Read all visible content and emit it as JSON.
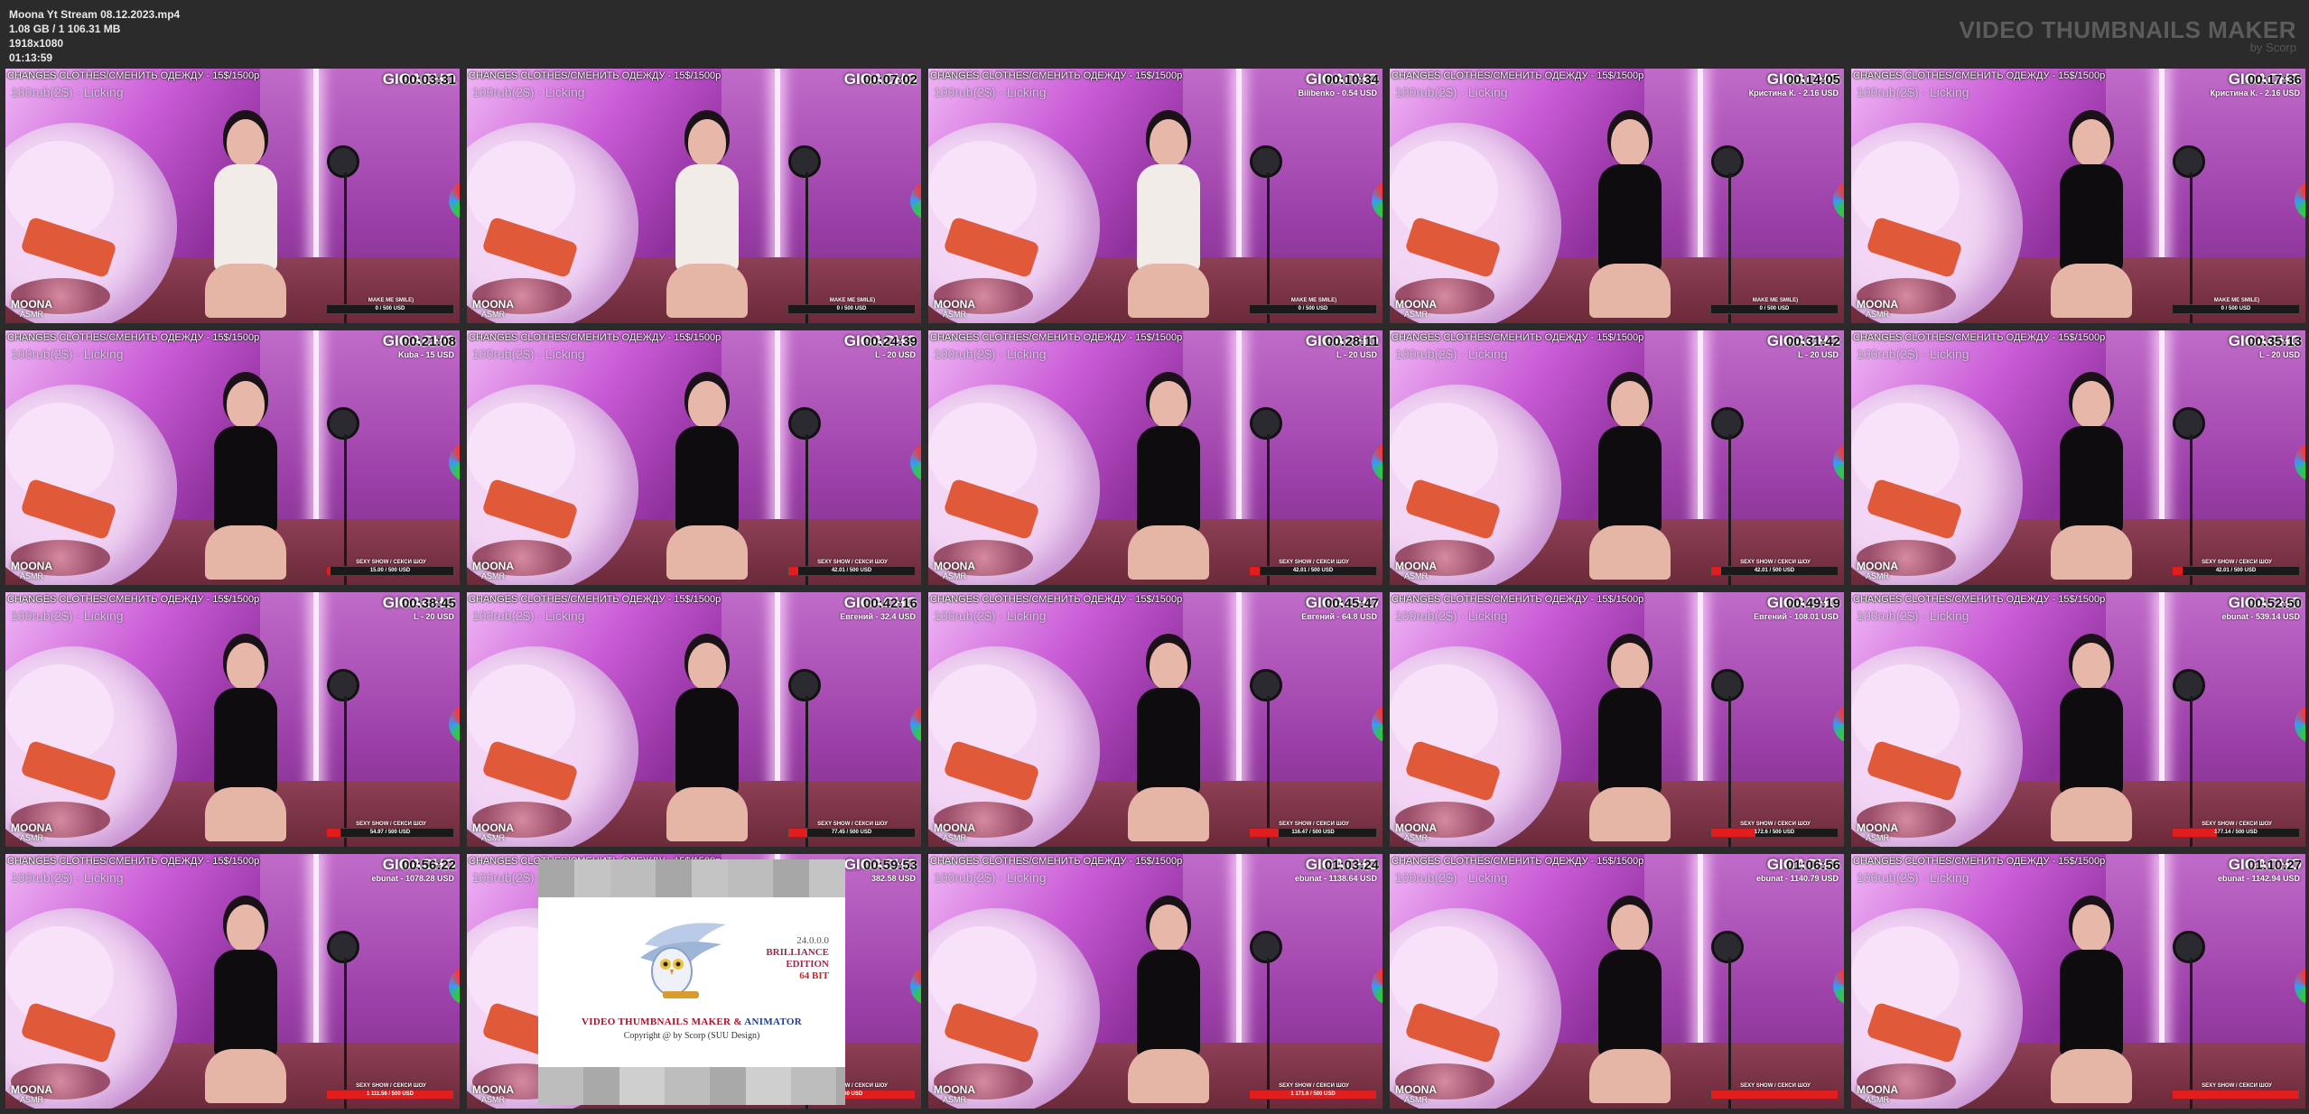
{
  "file": {
    "name": "Moona Yt Stream 08.12.2023.mp4",
    "size": "1.08 GB  / 1 106.31 MB",
    "resolution": "1918x1080",
    "duration": "01:13:59"
  },
  "brand": {
    "title": "VIDEO THUMBNAILS MAKER",
    "subtitle": "by Scorp"
  },
  "overlay": {
    "top_text": "CHANGES CLOTHES/СМЕНИТЬ ОДЕЖДУ - 15$/1500р",
    "sub_text": "100rub(2$) · Licking",
    "channel": "GIGACHO",
    "logo_name": "MOONA",
    "logo_sub": "ASMR"
  },
  "thumbnails": [
    {
      "time": "00:03:31",
      "donor": "",
      "goal_label": "MAKE ME SMILE)",
      "goal_value": "0 / 500 USD",
      "fill": 0.0,
      "outfit": "white"
    },
    {
      "time": "00:07:02",
      "donor": "",
      "goal_label": "MAKE ME SMILE)",
      "goal_value": "0 / 500 USD",
      "fill": 0.0,
      "outfit": "white"
    },
    {
      "time": "00:10:34",
      "donor": "Bilibenko - 0.54 USD",
      "goal_label": "MAKE ME SMILE)",
      "goal_value": "0 / 500 USD",
      "fill": 0.0,
      "outfit": "white"
    },
    {
      "time": "00:14:05",
      "donor": "Кристина К. - 2.16 USD",
      "goal_label": "MAKE ME SMILE)",
      "goal_value": "0 / 500 USD",
      "fill": 0.0,
      "outfit": "black"
    },
    {
      "time": "00:17:36",
      "donor": "Кристина К. - 2.16 USD",
      "goal_label": "MAKE ME SMILE)",
      "goal_value": "0 / 500 USD",
      "fill": 0.0,
      "outfit": "black"
    },
    {
      "time": "00:21:08",
      "donor": "Kuba - 15 USD",
      "goal_label": "SEXY SHOW / СЕКСИ ШОУ",
      "goal_value": "15.00 / 500 USD",
      "fill": 0.03,
      "outfit": "black"
    },
    {
      "time": "00:24:39",
      "donor": "L - 20 USD",
      "goal_label": "SEXY SHOW / СЕКСИ ШОУ",
      "goal_value": "42.01 / 500 USD",
      "fill": 0.08,
      "outfit": "black"
    },
    {
      "time": "00:28:11",
      "donor": "L - 20 USD",
      "goal_label": "SEXY SHOW / СЕКСИ ШОУ",
      "goal_value": "42.01 / 500 USD",
      "fill": 0.08,
      "outfit": "black"
    },
    {
      "time": "00:31:42",
      "donor": "L - 20 USD",
      "goal_label": "SEXY SHOW / СЕКСИ ШОУ",
      "goal_value": "42.01 / 500 USD",
      "fill": 0.08,
      "outfit": "black"
    },
    {
      "time": "00:35:13",
      "donor": "L - 20 USD",
      "goal_label": "SEXY SHOW / СЕКСИ ШОУ",
      "goal_value": "42.01 / 500 USD",
      "fill": 0.08,
      "outfit": "black"
    },
    {
      "time": "00:38:45",
      "donor": "L - 20 USD",
      "goal_label": "SEXY SHOW / СЕКСИ ШОУ",
      "goal_value": "54.97 / 500 USD",
      "fill": 0.11,
      "outfit": "black"
    },
    {
      "time": "00:42:16",
      "donor": "Евгений - 32.4 USD",
      "goal_label": "SEXY SHOW / СЕКСИ ШОУ",
      "goal_value": "77.45 / 500 USD",
      "fill": 0.15,
      "outfit": "black"
    },
    {
      "time": "00:45:47",
      "donor": "Евгений - 64.8 USD",
      "goal_label": "SEXY SHOW / СЕКСИ ШОУ",
      "goal_value": "116.47 / 500 USD",
      "fill": 0.23,
      "outfit": "black"
    },
    {
      "time": "00:49:19",
      "donor": "Евгений - 108.01 USD",
      "goal_label": "SEXY SHOW / СЕКСИ ШОУ",
      "goal_value": "172.6 / 500 USD",
      "fill": 0.35,
      "outfit": "black"
    },
    {
      "time": "00:52:50",
      "donor": "ebunat - 539.14 USD",
      "goal_label": "SEXY SHOW / СЕКСИ ШОУ",
      "goal_value": "177.14 / 500 USD",
      "fill": 0.35,
      "outfit": "black"
    },
    {
      "time": "00:56:22",
      "donor": "ebunat - 1078.28 USD",
      "goal_label": "SEXY SHOW / СЕКСИ ШОУ",
      "goal_value": "1 111.56 / 500 USD",
      "fill": 1.0,
      "outfit": "black"
    },
    {
      "time": "00:59:53",
      "donor": "382.58 USD",
      "goal_label": "SEXY SHOW / СЕКСИ ШОУ",
      "goal_value": "500 USD",
      "fill": 1.0,
      "outfit": "black"
    },
    {
      "time": "01:03:24",
      "donor": "ebunat - 1138.64 USD",
      "goal_label": "SEXY SHOW / СЕКСИ ШОУ",
      "goal_value": "1 171.6 / 500 USD",
      "fill": 1.0,
      "outfit": "black"
    },
    {
      "time": "01:06:56",
      "donor": "ebunat - 1140.79 USD",
      "goal_label": "SEXY SHOW / СЕКСИ ШОУ",
      "goal_value": "",
      "fill": 1.0,
      "outfit": "black"
    },
    {
      "time": "01:10:27",
      "donor": "ebunat - 1142.94 USD",
      "goal_label": "SEXY SHOW / СЕКСИ ШОУ",
      "goal_value": "",
      "fill": 1.0,
      "outfit": "black"
    }
  ],
  "about": {
    "version": "24.0.0.0",
    "edition1": "BRILLIANCE",
    "edition2": "EDITION",
    "bits": "64 BIT",
    "title_part1": "VIDEO THUMBNAILS MAKER",
    "title_amp": " & ",
    "title_part2": "ANIMATOR",
    "copyright": "Copyright @ by Scorp (SUU Design)"
  }
}
